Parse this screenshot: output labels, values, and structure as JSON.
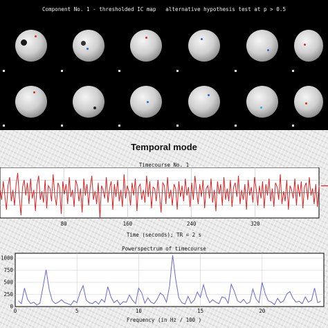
{
  "map_panel": {
    "title": "Component No. 1 - thresholded IC map   alternative hypothesis test at p > 0.5"
  },
  "heading": "Temporal mode",
  "timecourse": {
    "title": "Timecourse No. 1",
    "xlabel": "Time (seconds); TR = 2 s"
  },
  "powerspectrum": {
    "title": "Powerspectrum of timecourse",
    "xlabel": "Frequency (in Hz / 100 )"
  },
  "chart_data": [
    {
      "type": "line",
      "title": "Timecourse No. 1",
      "xlabel": "Time (seconds); TR = 2 s",
      "ylabel": "",
      "xlim": [
        0,
        400
      ],
      "xticks": [
        80,
        160,
        240,
        320
      ],
      "grid": true,
      "line_color": "#dd2222",
      "series": [
        {
          "values": [
            0.3,
            -0.5,
            0.8,
            -0.2,
            -1.2,
            0.5,
            1.1,
            -0.6,
            0.2,
            -0.9,
            0.6,
            1.4,
            -0.3,
            -1.6,
            0.4,
            0.9,
            -0.2,
            0.7,
            -0.8,
            1.0,
            -0.4,
            0.2,
            -1.3,
            0.6,
            1.2,
            -0.5,
            0.1,
            -0.7,
            0.9,
            -1.1,
            0.5,
            0.3,
            -0.6,
            1.3,
            -0.2,
            -0.9,
            0.7,
            0.4,
            -1.5,
            0.8,
            -0.1,
            0.6,
            -0.8,
            1.1,
            -0.3,
            0.2,
            -1.0,
            0.9,
            0.5,
            -0.6,
            0.3,
            -1.4,
            1.0,
            -0.2,
            0.6,
            -0.9,
            0.4,
            1.2,
            -0.5,
            0.1,
            -0.8,
            0.7,
            -1.8,
            0.5,
            0.2,
            -0.4,
            1.1,
            -0.7,
            0.3,
            0.8,
            -1.2,
            0.6,
            -0.3,
            0.9,
            -0.6,
            0.2,
            -1.0,
            1.3,
            -0.4,
            0.5,
            0.1,
            -0.9,
            0.7,
            -0.2,
            1.0,
            -1.3,
            0.4,
            0.6,
            -0.5,
            0.2,
            -0.7,
            1.2,
            -0.3,
            0.8,
            -1.1,
            0.4,
            0.3,
            -0.6,
            0.9,
            -0.2,
            -1.4,
            0.7,
            0.5,
            -0.8,
            1.1,
            -0.4,
            0.2,
            -0.9,
            0.6,
            0.3,
            -1.2,
            0.8,
            -0.3,
            0.5,
            -0.6,
            1.0,
            -0.2,
            0.4,
            -1.0,
            0.7,
            -0.5,
            1.2,
            0.1,
            -0.8,
            0.6,
            -0.3,
            0.9,
            -1.1,
            0.3,
            0.5,
            -0.4,
            1.0,
            -0.7,
            0.2,
            -1.3,
            0.8,
            -0.1,
            0.6,
            -0.9,
            1.1,
            -0.5,
            0.3,
            -0.6,
            0.9,
            -1.0,
            0.4,
            0.7,
            -0.3,
            1.2,
            -0.8,
            0.2,
            -0.5,
            0.6,
            -1.2,
            0.9,
            -0.2,
            0.4,
            -0.7,
            1.1,
            0.3,
            -0.9,
            0.5,
            -0.4,
            0.8,
            -1.1,
            0.6,
            -0.2,
            1.0,
            -0.6,
            0.3,
            -1.0,
            0.7,
            0.4,
            -0.5,
            1.3,
            -0.8,
            0.1,
            -0.6,
            0.9,
            -1.2,
            0.5,
            0.2,
            -0.4,
            1.0,
            -0.9,
            0.6,
            -0.3,
            0.8,
            -1.1,
            0.4,
            0.7,
            -0.5,
            1.1,
            -0.2,
            0.3,
            -0.8,
            0.6,
            -1.0,
            0.5
          ]
        }
      ]
    },
    {
      "type": "line",
      "title": "Powerspectrum of timecourse",
      "xlabel": "Frequency (in Hz / 100 )",
      "ylabel": "",
      "xlim": [
        0,
        25
      ],
      "ylim": [
        0,
        1100
      ],
      "xticks": [
        0,
        5,
        10,
        15,
        20
      ],
      "yticks": [
        0,
        250,
        500,
        750,
        1000
      ],
      "grid": true,
      "line_color": "#6666dd",
      "series": [
        {
          "x": [
            0.25,
            0.5,
            0.75,
            1.0,
            1.25,
            1.5,
            1.75,
            2.0,
            2.25,
            2.5,
            2.75,
            3.0,
            3.25,
            3.5,
            3.75,
            4.0,
            4.25,
            4.5,
            4.75,
            5.0,
            5.25,
            5.5,
            5.75,
            6.0,
            6.25,
            6.5,
            6.75,
            7.0,
            7.25,
            7.5,
            7.75,
            8.0,
            8.25,
            8.5,
            8.75,
            9.0,
            9.25,
            9.5,
            9.75,
            10.0,
            10.25,
            10.5,
            10.75,
            11.0,
            11.25,
            11.5,
            11.75,
            12.0,
            12.25,
            12.5,
            12.75,
            13.0,
            13.25,
            13.5,
            13.75,
            14.0,
            14.25,
            14.5,
            14.75,
            15.0,
            15.25,
            15.5,
            15.75,
            16.0,
            16.25,
            16.5,
            16.75,
            17.0,
            17.25,
            17.5,
            17.75,
            18.0,
            18.25,
            18.5,
            18.75,
            19.0,
            19.25,
            19.5,
            19.75,
            20.0,
            20.25,
            20.5,
            20.75,
            21.0,
            21.25,
            21.5,
            21.75,
            22.0,
            22.25,
            22.5,
            22.75,
            23.0,
            23.25,
            23.5,
            23.75,
            24.0,
            24.25,
            24.5,
            24.75
          ],
          "values": [
            120,
            60,
            380,
            150,
            60,
            90,
            30,
            70,
            400,
            760,
            350,
            120,
            60,
            90,
            140,
            80,
            60,
            30,
            120,
            80,
            290,
            430,
            130,
            80,
            60,
            110,
            50,
            150,
            90,
            410,
            200,
            80,
            130,
            40,
            100,
            90,
            240,
            130,
            60,
            380,
            280,
            70,
            180,
            90,
            60,
            150,
            280,
            230,
            90,
            420,
            1060,
            560,
            180,
            80,
            50,
            210,
            70,
            130,
            300,
            190,
            450,
            220,
            80,
            140,
            90,
            60,
            200,
            180,
            70,
            460,
            310,
            120,
            80,
            150,
            60,
            90,
            360,
            160,
            80,
            500,
            260,
            120,
            90,
            40,
            170,
            80,
            120,
            260,
            310,
            170,
            90,
            110,
            60,
            200,
            90,
            130,
            380,
            80,
            110
          ]
        }
      ]
    }
  ]
}
